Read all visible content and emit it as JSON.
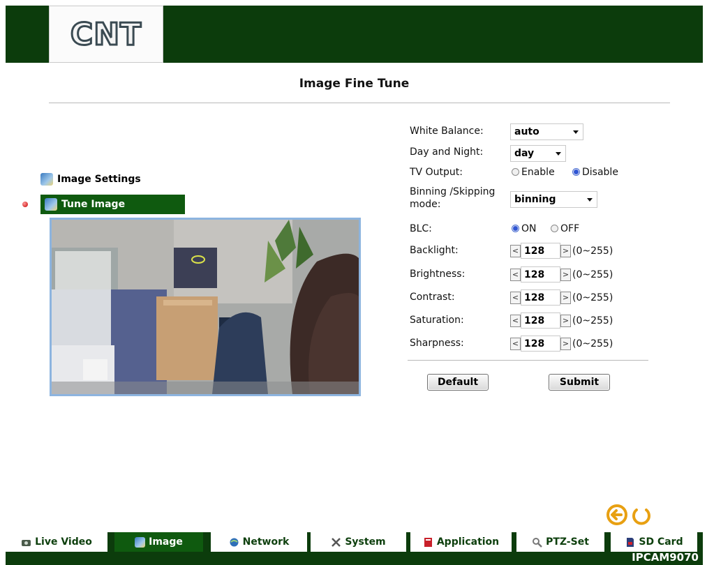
{
  "logo": {
    "text": "CNT"
  },
  "page": {
    "title": "Image Fine Tune"
  },
  "sidebar": {
    "items": [
      {
        "label": "Image Settings",
        "icon": "image-settings-icon"
      },
      {
        "label": "Tune Image",
        "icon": "tune-image-icon",
        "active": true
      }
    ]
  },
  "settings": {
    "white_balance": {
      "label": "White Balance:",
      "value": "auto"
    },
    "day_night": {
      "label": "Day and Night:",
      "value": "day"
    },
    "tv_output": {
      "label": "TV Output:",
      "options": [
        "Enable",
        "Disable"
      ],
      "selected": "Disable"
    },
    "binning": {
      "label_line1": "Binning /Skipping",
      "label_line2": "mode:",
      "value": "binning"
    },
    "blc": {
      "label": "BLC:",
      "options": [
        "ON",
        "OFF"
      ],
      "selected": "ON"
    },
    "steppers": [
      {
        "label": "Backlight:",
        "value": "128",
        "range": "(0~255)"
      },
      {
        "label": "Brightness:",
        "value": "128",
        "range": "(0~255)"
      },
      {
        "label": "Contrast:",
        "value": "128",
        "range": "(0~255)"
      },
      {
        "label": "Saturation:",
        "value": "128",
        "range": "(0~255)"
      },
      {
        "label": "Sharpness:",
        "value": "128",
        "range": "(0~255)"
      }
    ],
    "dec_symbol": "<",
    "inc_symbol": ">"
  },
  "buttons": {
    "default": "Default",
    "submit": "Submit"
  },
  "tabs": [
    {
      "label": "Live Video",
      "icon": "live-video-icon"
    },
    {
      "label": "Image",
      "icon": "image-icon",
      "active": true
    },
    {
      "label": "Network",
      "icon": "network-icon"
    },
    {
      "label": "System",
      "icon": "system-icon"
    },
    {
      "label": "Application",
      "icon": "application-icon"
    },
    {
      "label": "PTZ-Set",
      "icon": "ptz-set-icon"
    },
    {
      "label": "SD Card",
      "icon": "sd-card-icon"
    }
  ],
  "model": "IPCAM9070",
  "colors": {
    "frame": "#0c3c0c",
    "active": "#0f5a0f",
    "accent_orange": "#e8a012"
  }
}
